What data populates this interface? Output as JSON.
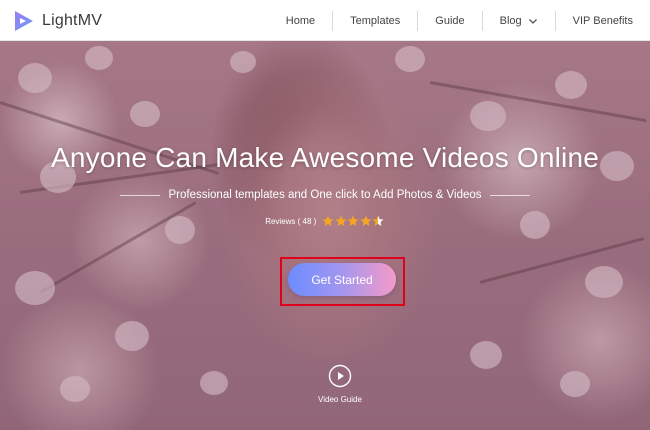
{
  "header": {
    "logo_text": "LightMV",
    "nav": [
      {
        "label": "Home"
      },
      {
        "label": "Templates"
      },
      {
        "label": "Guide"
      },
      {
        "label": "Blog",
        "has_dropdown": true
      },
      {
        "label": "VIP Benefits"
      }
    ]
  },
  "hero": {
    "headline": "Anyone Can Make Awesome Videos Online",
    "subline": "Professional templates and One click to Add Photos & Videos",
    "reviews_label": "Reviews ( 48 )",
    "rating": 4.5,
    "rating_max": 5,
    "cta_label": "Get Started",
    "video_guide_label": "Video Guide"
  },
  "colors": {
    "cta_gradient_start": "#6b8cff",
    "cta_gradient_end": "#f49ac7",
    "star": "#f5a623",
    "highlight_box": "#e0001b"
  },
  "icons": {
    "logo": "play-triangle-logo-icon",
    "blog_dropdown": "chevron-down-icon",
    "video_guide": "play-circle-icon",
    "rating": "star-icon"
  }
}
